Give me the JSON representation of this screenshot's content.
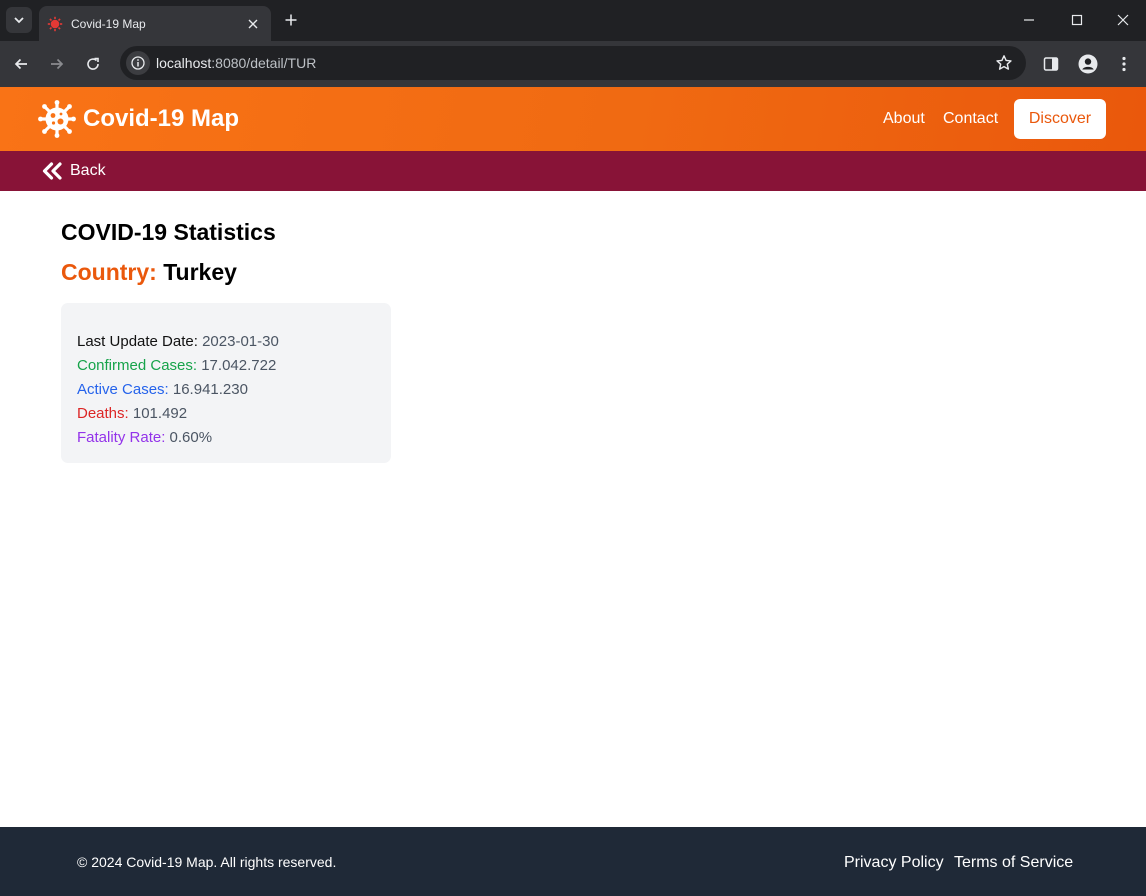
{
  "browser": {
    "tab_title": "Covid-19 Map",
    "url_host": "localhost",
    "url_rest": ":8080/detail/TUR"
  },
  "header": {
    "brand": "Covid-19 Map",
    "nav": [
      "About",
      "Contact"
    ],
    "cta": "Discover"
  },
  "subnav": {
    "back_label": "Back"
  },
  "main": {
    "title": "COVID-19 Statistics",
    "country_label": "Country:",
    "country_name": "Turkey",
    "stats": [
      {
        "label": "Last Update Date:",
        "value": "2023-01-30"
      },
      {
        "label": "Confirmed Cases:",
        "value": "17.042.722"
      },
      {
        "label": "Active Cases:",
        "value": "16.941.230"
      },
      {
        "label": "Deaths:",
        "value": "101.492"
      },
      {
        "label": "Fatality Rate:",
        "value": "0.60%"
      }
    ]
  },
  "footer": {
    "copyright": "© 2024 Covid-19 Map. All rights reserved.",
    "links": [
      "Privacy Policy",
      "Terms of Service"
    ]
  },
  "colors": {
    "header_orange": "#f97316",
    "accent_orange": "#ea580c",
    "subbar": "#881337",
    "footer": "#1f2937",
    "confirmed": "#16a34a",
    "active": "#2563eb",
    "deaths": "#dc2626",
    "fatality": "#9333ea"
  },
  "icons": [
    "tab-list-icon",
    "virus-icon",
    "close-icon",
    "plus-icon",
    "minimize-icon",
    "maximize-icon",
    "back-arrow-icon",
    "forward-arrow-icon",
    "reload-icon",
    "info-icon",
    "star-icon",
    "side-panel-icon",
    "profile-icon",
    "more-vert-icon",
    "double-chevron-left-icon"
  ]
}
